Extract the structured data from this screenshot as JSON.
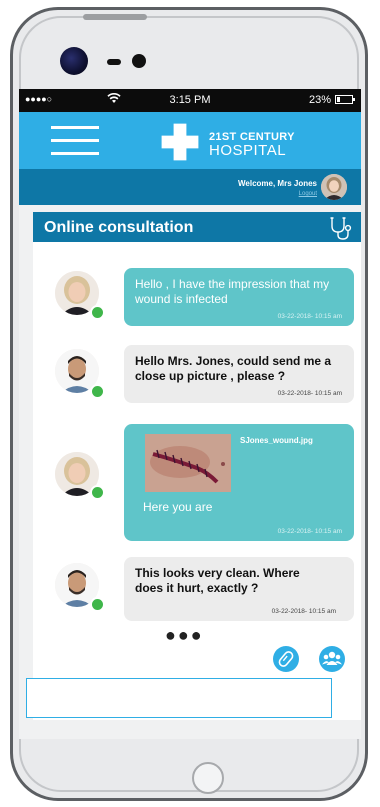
{
  "status_bar": {
    "signal": "●●●●○",
    "time": "3:15 PM",
    "battery_percent": "23%",
    "battery_level": 0.23
  },
  "header": {
    "logo_line1": "21ST CENTURY",
    "logo_line2": "HOSPITAL"
  },
  "welcome": {
    "text": "Welcome, Mrs  Jones",
    "logout": "Logout"
  },
  "chat": {
    "title": "Online consultation",
    "messages": [
      {
        "sender": "patient",
        "text": "Hello , I have the impression that my wound is infected",
        "timestamp": "03-22-2018- 10:15 am"
      },
      {
        "sender": "doctor",
        "text": "Hello Mrs. Jones, could send me a close up picture , please ?",
        "timestamp": "03-22-2018- 10:15 am"
      },
      {
        "sender": "patient",
        "attachment": "SJones_wound.jpg",
        "text": "Here you are",
        "timestamp": "03-22-2018- 10:15 am"
      },
      {
        "sender": "doctor",
        "text": "This looks very clean. Where does it hurt, exactly ?",
        "timestamp": "03-22-2018- 10:15 am"
      }
    ],
    "typing_indicator": "●●●",
    "input_placeholder": ""
  },
  "colors": {
    "brand_blue": "#2faee5",
    "dark_blue": "#0e77a6",
    "patient_bubble": "#5fc5c9",
    "doctor_bubble": "#ececec",
    "online": "#3fb64a"
  }
}
